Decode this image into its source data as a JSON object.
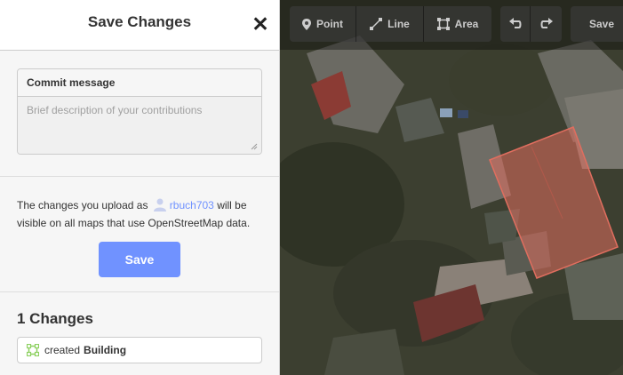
{
  "sidebar": {
    "title": "Save Changes",
    "close_icon": "close-icon",
    "commit": {
      "label": "Commit message",
      "placeholder": "Brief description of your contributions",
      "value": ""
    },
    "upload": {
      "prefix": "The changes you upload as",
      "username": "rbuch703",
      "suffix": "will be visible on all maps that use OpenStreetMap data."
    },
    "save_label": "Save",
    "changes": {
      "title": "1 Changes",
      "items": [
        {
          "icon": "area-icon",
          "action": "created",
          "feature": "Building"
        }
      ]
    }
  },
  "toolbar": {
    "point_label": "Point",
    "line_label": "Line",
    "area_label": "Area",
    "undo_icon": "undo-icon",
    "redo_icon": "redo-icon",
    "save_label": "Save"
  },
  "colors": {
    "accent": "#7092ff",
    "building_fill": "#e06e5f",
    "area_icon": "#8cd05f"
  }
}
